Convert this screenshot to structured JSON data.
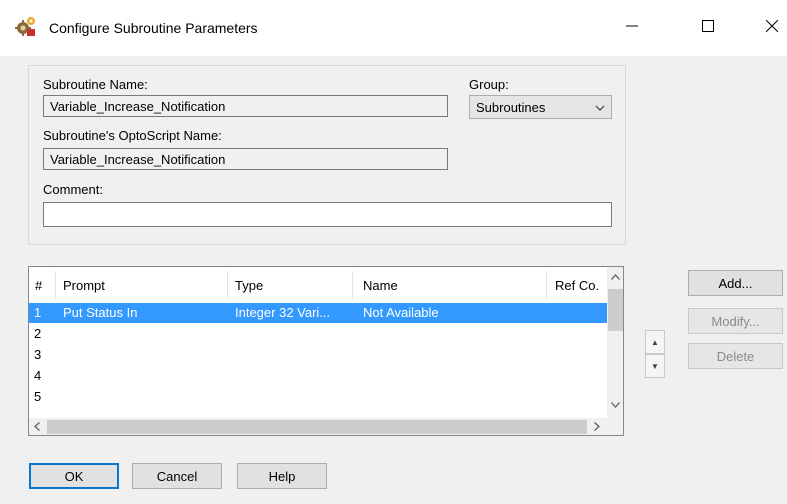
{
  "window": {
    "title": "Configure Subroutine Parameters",
    "controls": {
      "minimize": "minimize",
      "maximize": "maximize",
      "close": "close"
    }
  },
  "form": {
    "subroutine_name_label": "Subroutine Name:",
    "subroutine_name_value": "Variable_Increase_Notification",
    "group_label": "Group:",
    "group_value": "Subroutines",
    "optoscript_name_label": "Subroutine's OptoScript Name:",
    "optoscript_name_value": "Variable_Increase_Notification",
    "comment_label": "Comment:",
    "comment_value": ""
  },
  "table": {
    "columns": [
      "#",
      "Prompt",
      "Type",
      "Name",
      "Ref Co."
    ],
    "rows": [
      {
        "num": "1",
        "prompt": "Put Status In",
        "type": "Integer 32 Vari...",
        "name": "Not Available",
        "selected": true
      },
      {
        "num": "2",
        "prompt": "",
        "type": "",
        "name": ""
      },
      {
        "num": "3",
        "prompt": "",
        "type": "",
        "name": ""
      },
      {
        "num": "4",
        "prompt": "",
        "type": "",
        "name": ""
      },
      {
        "num": "5",
        "prompt": "",
        "type": "",
        "name": ""
      }
    ]
  },
  "side_buttons": {
    "add": "Add...",
    "modify": "Modify...",
    "delete": "Delete"
  },
  "bottom_buttons": {
    "ok": "OK",
    "cancel": "Cancel",
    "help": "Help"
  },
  "colors": {
    "selection": "#3399ff",
    "default_border": "#0078d7"
  }
}
